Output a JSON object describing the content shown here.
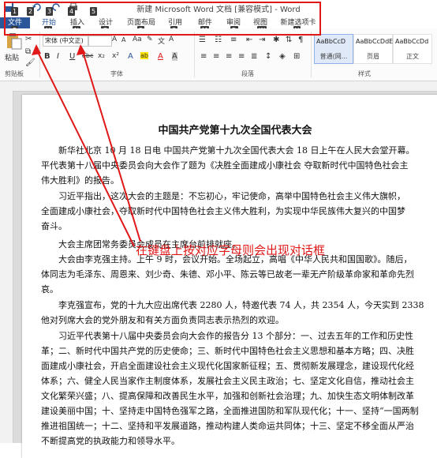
{
  "title_bar": {
    "text": "新建 Microsoft Word 文档 [兼容模式] - Word"
  },
  "quick_access_keytips": [
    "1",
    "2",
    "3",
    "4",
    "5"
  ],
  "tabs": [
    {
      "label": "文件",
      "keytip": "F"
    },
    {
      "label": "开始",
      "keytip": "H"
    },
    {
      "label": "插入",
      "keytip": "N"
    },
    {
      "label": "设计",
      "keytip": "G"
    },
    {
      "label": "页面布局",
      "keytip": "P"
    },
    {
      "label": "引用",
      "keytip": "S"
    },
    {
      "label": "邮件",
      "keytip": "M"
    },
    {
      "label": "审阅",
      "keytip": "R"
    },
    {
      "label": "视图",
      "keytip": "W"
    },
    {
      "label": "新建选项卡",
      "keytip": "Y"
    }
  ],
  "ribbon": {
    "paste_label": "粘贴",
    "clipboard_label": "剪贴板",
    "font_name": "宋体 (中文正)",
    "font_group_label": "字体",
    "paragraph_group_label": "段落",
    "styles_group_label": "样式",
    "format_buttons": [
      "B",
      "I",
      "U",
      "abc",
      "x₂",
      "x²",
      "A",
      "ab",
      "A",
      "A"
    ],
    "styles": [
      {
        "sample": "AaBbCcD",
        "name": "普通(网...",
        "selected": true
      },
      {
        "sample": "AaBbCcDdE",
        "name": "页眉"
      },
      {
        "sample": "AaBbCcDd",
        "name": "正文"
      }
    ]
  },
  "document": {
    "title": "中国共产党第十九次全国代表大会",
    "paragraphs": [
      "新华社北京 10 月 18 日电  中国共产党第十九次全国代表大会 18 日上午在人民大会堂开幕。",
      "平代表第十八届中央委员会向大会作了题为《决胜全面建成小康社会 夺取新时代中国特色社会主",
      "伟大胜利》的报告。",
      "习近平指出，这次大会的主题是：不忘初心，牢记使命，高举中国特色社会主义伟大旗帜，",
      "全面建成小康社会，夺取新时代中国特色社会主义伟大胜利，为实现中华民族伟大复兴的中国梦",
      "奋斗。",
      "大会主席团常务委员会成员在主席台前排就座。",
      "大会由李克强主持。上午 9 时，会议开始。全场起立，高唱《中华人民共和国国歌》。随后，",
      "体同志为毛泽东、周恩来、刘少奇、朱德、邓小平、陈云等已故老一辈无产阶级革命家和革命先烈",
      "哀。",
      "李克强宣布，党的十九大应出席代表 2280 人，特邀代表 74 人，共 2354 人，今天实到 2338",
      "他对列席大会的党外朋友和有关方面负责同志表示热烈的欢迎。",
      "习近平代表第十八届中央委员会向大会作的报告分 13 个部分：一、过去五年的工作和历史性",
      "革；二、新时代中国共产党的历史使命；三、新时代中国特色社会主义思想和基本方略；四、决胜",
      "面建成小康社会，开启全面建设社会主义现代化国家新征程；五、贯彻新发展理念，建设现代化经",
      "体系；六、健全人民当家作主制度体系，发展社会主义民主政治；七、坚定文化自信，推动社会主",
      "文化繁荣兴盛；八、提高保障和改善民生水平，加强和创新社会治理；九、加快生态文明体制改革",
      "建设美丽中国；十、坚持走中国特色强军之路，全面推进国防和军队现代化；十一、坚持“一国两制",
      "推进祖国统一；十二、坚持和平发展道路，推动构建人类命运共同体；十三、坚定不移全面从严治",
      "不断提高党的执政能力和领导水平。"
    ],
    "annotation": "在键盘上按对应字母则会出现对话框"
  }
}
